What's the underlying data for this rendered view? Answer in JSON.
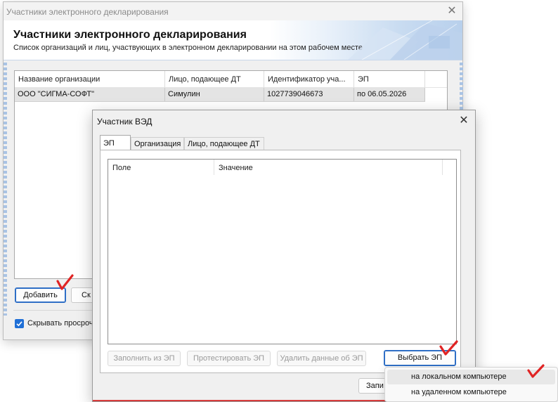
{
  "main_window": {
    "title": "Участники электронного декларирования",
    "heading": "Участники электронного декларирования",
    "subheading": "Список организаций и лиц, участвующих в электронном декларировании на этом рабочем месте",
    "table": {
      "columns": [
        "Название организации",
        "Лицо, подающее ДТ",
        "Идентификатор уча...",
        "ЭП"
      ],
      "rows": [
        [
          "ООО \"СИГМА-СОФТ\"",
          "Симулин",
          "1027739046673",
          "по 06.05.2026"
        ]
      ]
    },
    "add_button": "Добавить",
    "partial_button": "Ск",
    "hide_expired_label": "Скрывать просроче",
    "hide_expired_checked": true
  },
  "dialog": {
    "title": "Участник ВЭД",
    "tabs": [
      "ЭП",
      "Организация",
      "Лицо, подающее ДТ"
    ],
    "active_tab": "ЭП",
    "grid_columns": [
      "Поле",
      "Значение"
    ],
    "buttons": {
      "fill": "Заполнить из ЭП",
      "test": "Протестировать ЭП",
      "delete": "Удалить данные об ЭП",
      "choose": "Выбрать ЭП",
      "save_partial": "Запи"
    }
  },
  "dropdown_menu": {
    "items": [
      "на локальном компьютере",
      "на удаленном компьютере"
    ],
    "highlighted": "на локальном компьютере"
  },
  "colors": {
    "accent": "#2f6fc6",
    "checkbox": "#1f6fd6",
    "annotation_check": "#e02424",
    "header_gradient_end": "#b8d0ec"
  }
}
